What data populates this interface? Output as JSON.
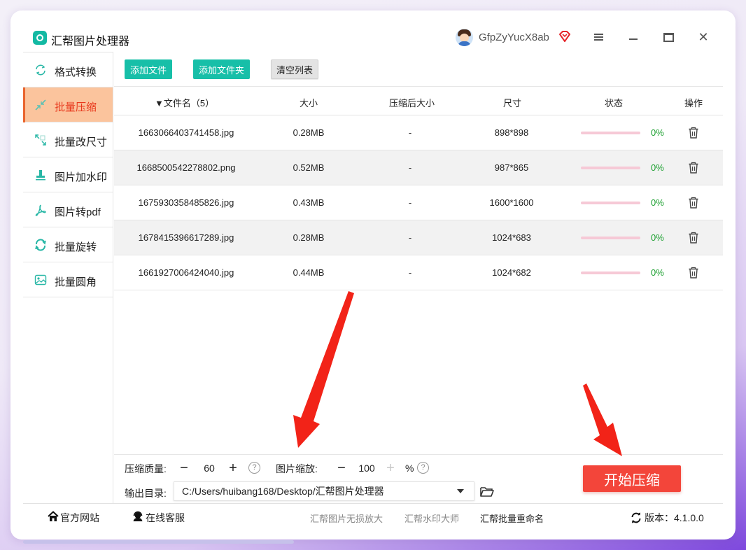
{
  "app": {
    "title": "汇帮图片处理器",
    "username": "GfpZyYucX8ab"
  },
  "colors": {
    "accent": "#17bfa8",
    "active_bg": "#fbc49d",
    "active_text": "#e8391d",
    "start_button": "#f3453a",
    "progress_track": "#f6c9d6",
    "percent_text": "#1a9f2e"
  },
  "sidebar": {
    "items": [
      {
        "label": "格式转换",
        "icon": "format-convert-icon"
      },
      {
        "label": "批量压缩",
        "icon": "compress-icon",
        "active": true
      },
      {
        "label": "批量改尺寸",
        "icon": "resize-icon"
      },
      {
        "label": "图片加水印",
        "icon": "watermark-icon"
      },
      {
        "label": "图片转pdf",
        "icon": "pdf-icon"
      },
      {
        "label": "批量旋转",
        "icon": "rotate-icon"
      },
      {
        "label": "批量圆角",
        "icon": "rounded-corner-icon"
      }
    ]
  },
  "toolbar": {
    "add_files": "添加文件",
    "add_folder": "添加文件夹",
    "clear_list": "清空列表"
  },
  "table": {
    "headers": {
      "filename": "文件名（5）",
      "size": "大小",
      "compressed_size": "压缩后大小",
      "dimensions": "尺寸",
      "status": "状态",
      "action": "操作"
    },
    "rows": [
      {
        "name": "1663066403741458.jpg",
        "size": "0.28MB",
        "compressed": "-",
        "dims": "898*898",
        "progress": "0%"
      },
      {
        "name": "1668500542278802.png",
        "size": "0.52MB",
        "compressed": "-",
        "dims": "987*865",
        "progress": "0%"
      },
      {
        "name": "1675930358485826.jpg",
        "size": "0.43MB",
        "compressed": "-",
        "dims": "1600*1600",
        "progress": "0%"
      },
      {
        "name": "1678415396617289.jpg",
        "size": "0.28MB",
        "compressed": "-",
        "dims": "1024*683",
        "progress": "0%"
      },
      {
        "name": "1661927006424040.jpg",
        "size": "0.44MB",
        "compressed": "-",
        "dims": "1024*682",
        "progress": "0%"
      }
    ]
  },
  "settings": {
    "quality_label": "压缩质量:",
    "quality_value": "60",
    "scale_label": "图片缩放:",
    "scale_value": "100",
    "scale_unit": "%",
    "minus": "−",
    "plus": "+",
    "help": "?",
    "output_label": "输出目录:",
    "output_path": "C:/Users/huibang168/Desktop/汇帮图片处理器"
  },
  "start_button": "开始压缩",
  "footer": {
    "website": "官方网站",
    "support": "在线客服",
    "link1": "汇帮图片无损放大",
    "link2": "汇帮水印大师",
    "link3": "汇帮批量重命名",
    "version": "版本：4.1.0.0"
  }
}
